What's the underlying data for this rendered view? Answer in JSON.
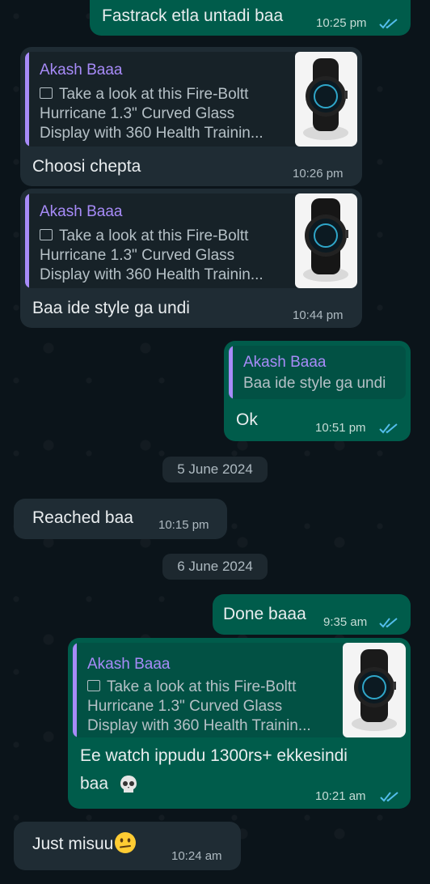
{
  "messages": [
    {
      "text": "Fastrack etla untadi baa",
      "time": "10:25 pm"
    },
    {
      "quote_name": "Akash Baaa",
      "quote_lines": [
        "Take a look at this Fire-Boltt",
        "Hurricane 1.3\" Curved Glass",
        "Display with 360 Health Trainin..."
      ],
      "text": "Choosi chepta",
      "time": "10:26 pm"
    },
    {
      "quote_name": "Akash Baaa",
      "quote_lines": [
        "Take a look at this Fire-Boltt",
        "Hurricane 1.3\" Curved Glass",
        "Display with 360 Health Trainin..."
      ],
      "text": "Baa ide style ga undi",
      "time": "10:44 pm"
    },
    {
      "quote_name": "Akash Baaa",
      "quote_text": "Baa ide style ga undi",
      "text": "Ok",
      "time": "10:51 pm"
    },
    {
      "text": "Reached baa",
      "time": "10:15 pm"
    },
    {
      "text": "Done baaa",
      "time": "9:35 am"
    },
    {
      "quote_name": "Akash Baaa",
      "quote_lines": [
        "Take a look at this Fire-Boltt",
        "Hurricane 1.3\" Curved Glass",
        "Display with 360 Health Trainin..."
      ],
      "text_line1": "Ee watch ippudu 1300rs+ ekkesindi",
      "text_line2": "baa",
      "time": "10:21 am"
    },
    {
      "text": "Just misuu",
      "time": "10:24 am"
    }
  ],
  "dates": [
    "5 June 2024",
    "6 June 2024"
  ],
  "icons": {
    "read_receipt": "double-check-icon",
    "image": "image-icon",
    "skull": "skull-emoji",
    "confused": "confused-face-emoji"
  },
  "colors": {
    "incoming": "#1f2c34",
    "outgoing": "#005c4b",
    "quote_accent": "#a78bf8",
    "read_tick": "#53bdeb"
  }
}
